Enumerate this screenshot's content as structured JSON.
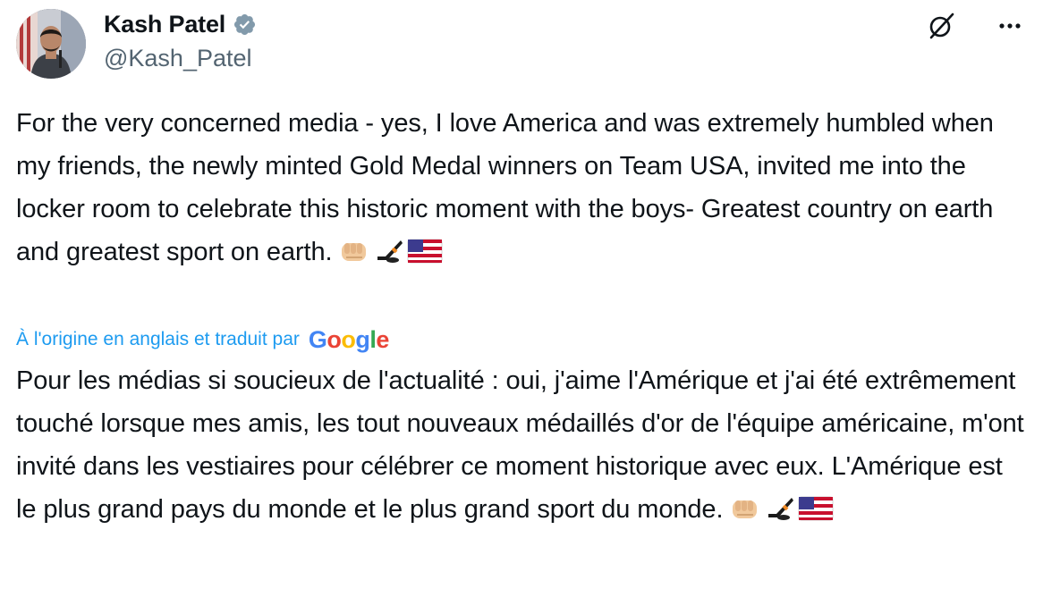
{
  "author": {
    "display_name": "Kash Patel",
    "handle": "@Kash_Patel",
    "verified": true
  },
  "icons": {
    "verified": "verified-badge-icon",
    "grok": "grok-icon",
    "more": "more-options-icon",
    "emojis": [
      "fist-bump-emoji",
      "ice-hockey-emoji",
      "us-flag-emoji"
    ]
  },
  "tweet": {
    "original_text": "For the very concerned media - yes, I love America and was extremely humbled when my friends, the newly minted Gold Medal winners on Team USA, invited me into the locker room to celebrate this historic moment with the boys- Greatest country on earth and greatest sport on earth.",
    "translation_note": "À l'origine en anglais et traduit par",
    "translation_provider": "Google",
    "translated_text": "Pour les médias si soucieux de l'actualité : oui, j'aime l'Amérique et j'ai été extrêmement touché lorsque mes amis, les tout nouveaux médaillés d'or de l'équipe américaine, m'ont invité dans les vestiaires pour célébrer ce moment historique avec eux. L'Amérique est le plus grand pays du monde et le plus grand sport du monde."
  },
  "colors": {
    "text": "#0f1419",
    "secondary_text": "#536471",
    "link": "#1d9bf0",
    "verified_badge": "#829aab"
  }
}
